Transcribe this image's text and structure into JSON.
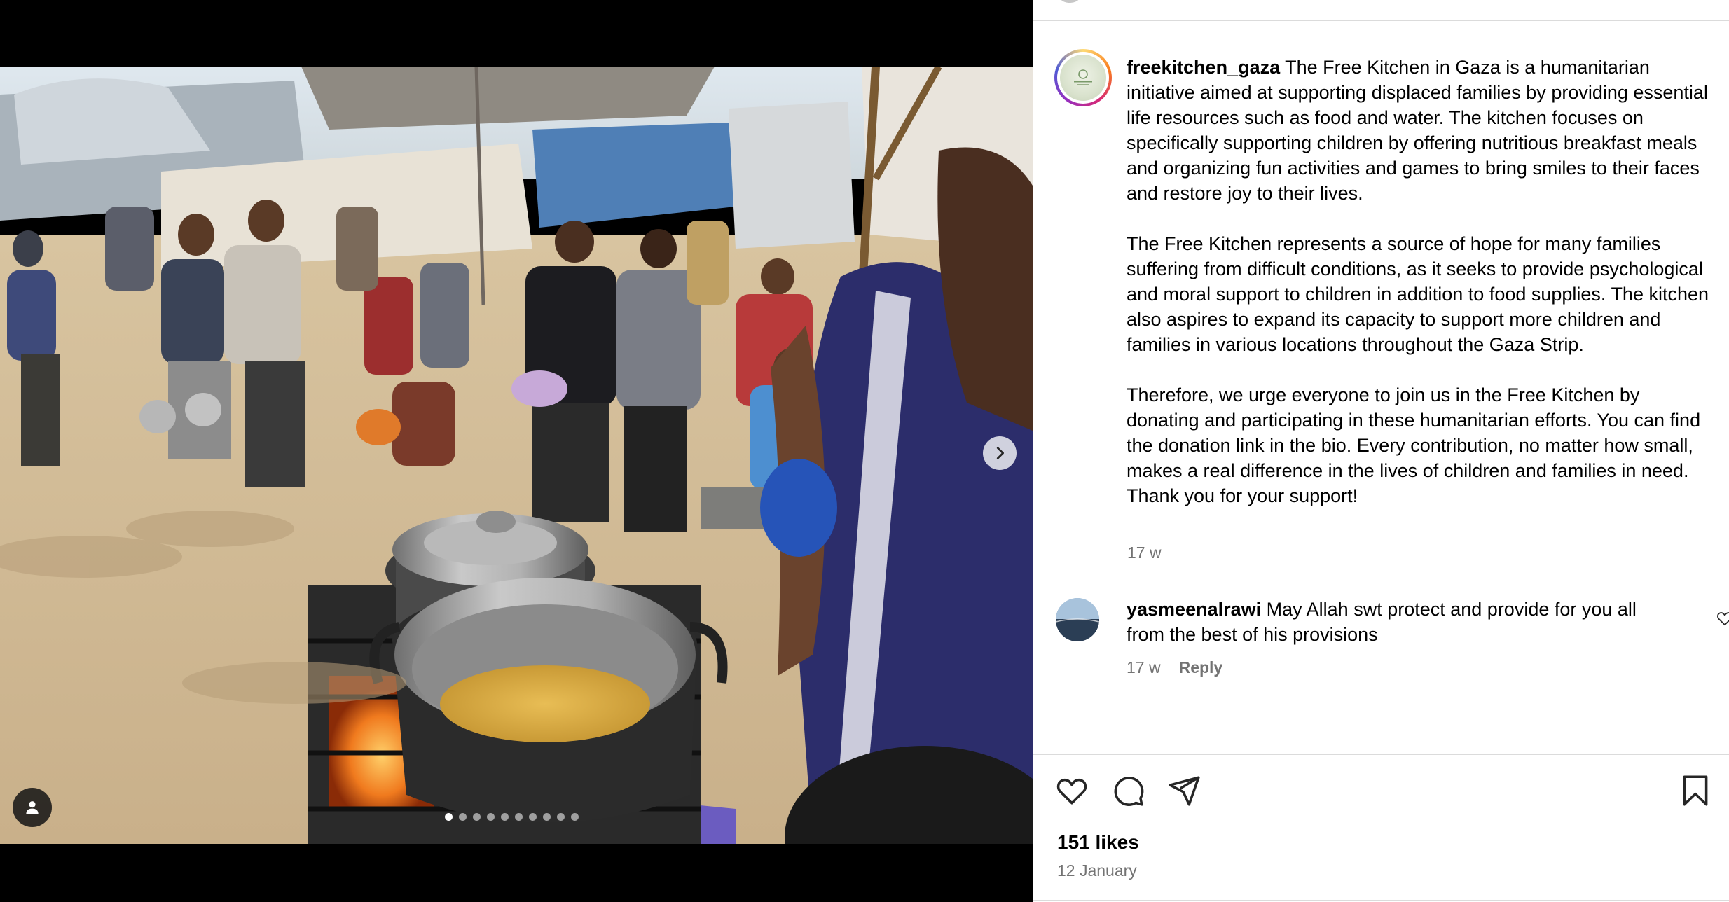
{
  "post": {
    "username": "freekitchen_gaza",
    "caption_paragraphs": [
      "The Free Kitchen in Gaza is a humanitarian initiative aimed at supporting displaced families by providing essential life resources such as food and water. The kitchen focuses on specifically supporting children by offering nutritious breakfast meals and organizing fun activities and games to bring smiles to their faces and restore joy to their lives.",
      "The Free Kitchen represents a source of hope for many families suffering from difficult conditions, as it seeks to provide psychological and moral support to children in addition to food supplies. The kitchen also aspires to expand its capacity to support more children and families in various locations throughout the Gaza Strip.",
      "Therefore, we urge everyone to join us in the Free Kitchen by donating and participating in these humanitarian efforts. You can find the donation link in the bio. Every contribution, no matter how small, makes a real difference in the lives of children and families in need. Thank you for your support!"
    ],
    "caption_age": "17 w",
    "likes": "151 likes",
    "date": "12 January"
  },
  "comments": [
    {
      "username": "yasmeenalrawi",
      "text": "May Allah swt protect and provide for you all from the best of his provisions",
      "age": "17 w",
      "reply_label": "Reply"
    }
  ],
  "carousel": {
    "slide_count": 10,
    "active_index": 0
  },
  "icons": {
    "next": "chevron-right-icon",
    "tag": "user-tag-icon",
    "like": "heart-icon",
    "comment": "comment-bubble-icon",
    "share": "paper-plane-icon",
    "save": "bookmark-icon"
  },
  "colors": {
    "text_primary": "#000000",
    "text_secondary": "#737373",
    "divider": "#dbdbdb",
    "media_background": "#000000"
  }
}
